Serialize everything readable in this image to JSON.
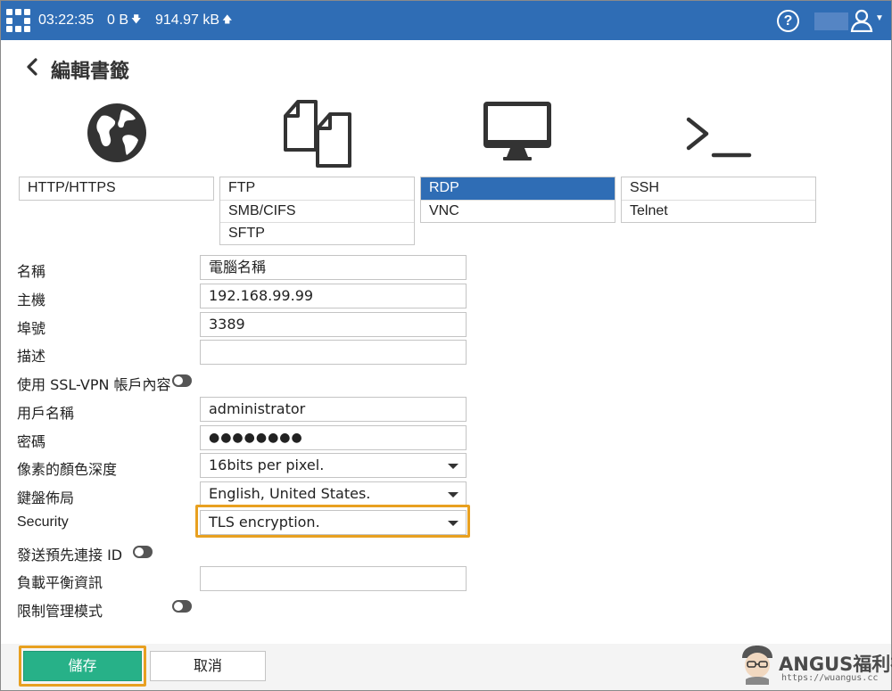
{
  "header": {
    "time": "03:22:35",
    "download": "0 B",
    "upload": "914.97 kB",
    "down_arrow": "🡇",
    "up_arrow": "🡅",
    "help": "?",
    "accent_color": "#2f6db5"
  },
  "page": {
    "title": "編輯書籤"
  },
  "protocols": {
    "groups": [
      {
        "icon": "globe-icon",
        "options": [
          "HTTP/HTTPS"
        ]
      },
      {
        "icon": "files-icon",
        "options": [
          "FTP",
          "SMB/CIFS",
          "SFTP"
        ]
      },
      {
        "icon": "monitor-icon",
        "options": [
          "RDP",
          "VNC"
        ]
      },
      {
        "icon": "terminal-icon",
        "options": [
          "SSH",
          "Telnet"
        ]
      }
    ],
    "selected": "RDP"
  },
  "form": {
    "name": {
      "label": "名稱",
      "value": "電腦名稱"
    },
    "host": {
      "label": "主機",
      "value": "192.168.99.99"
    },
    "port": {
      "label": "埠號",
      "value": "3389"
    },
    "description": {
      "label": "描述",
      "value": ""
    },
    "use_sslvpn_credentials": {
      "label": "使用 SSL-VPN 帳戶內容",
      "enabled": false
    },
    "username": {
      "label": "用戶名稱",
      "value": "administrator"
    },
    "password": {
      "label": "密碼",
      "value": "●●●●●●●●"
    },
    "color_depth": {
      "label": "像素的顏色深度",
      "value": "16bits per pixel."
    },
    "keyboard_layout": {
      "label": "鍵盤佈局",
      "value": "English, United States."
    },
    "security": {
      "label": "Security",
      "value": "TLS encryption."
    },
    "send_preconnection_id": {
      "label": "發送預先連接 ID",
      "enabled": false
    },
    "load_balancing_info": {
      "label": "負載平衡資訊",
      "value": ""
    },
    "restricted_admin_mode": {
      "label": "限制管理模式",
      "enabled": false
    }
  },
  "footer": {
    "save_label": "儲存",
    "cancel_label": "取消",
    "save_color": "#27b188",
    "highlight_color": "#e8a020"
  },
  "watermark": {
    "brand": "ANGUS福利社",
    "url": "https://wuangus.cc"
  }
}
